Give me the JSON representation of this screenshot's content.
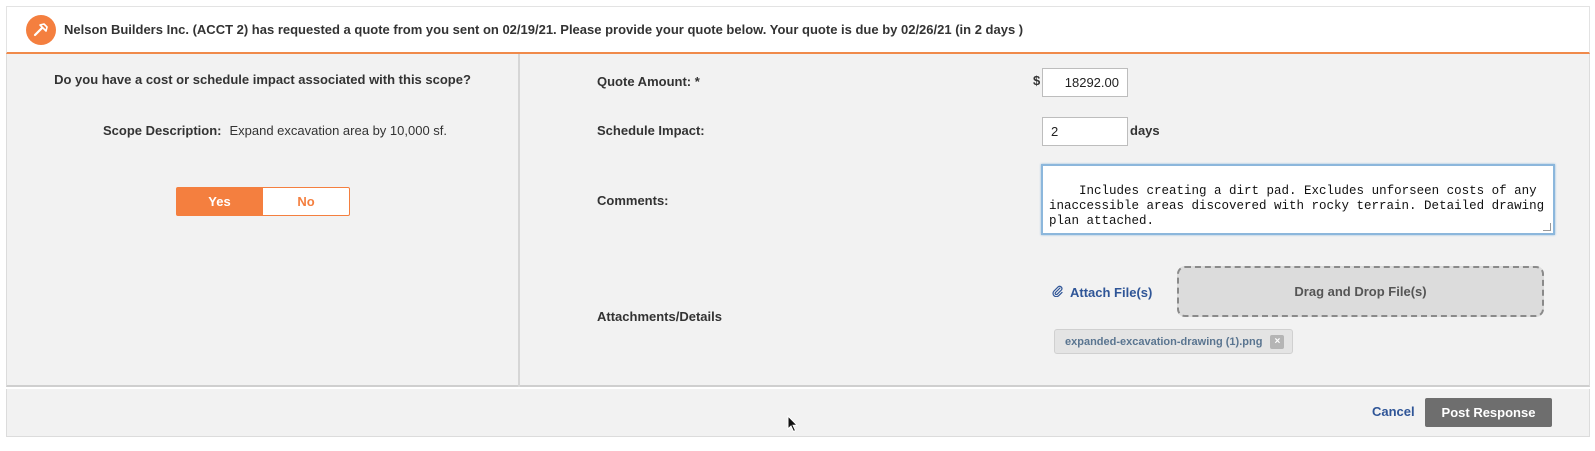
{
  "banner": {
    "icon": "hammer-icon",
    "message": "Nelson Builders Inc. (ACCT 2) has requested a quote from you sent on 02/19/21. Please provide your quote below. Your quote is due by 02/26/21 (in 2 days )"
  },
  "left": {
    "question": "Do you have a cost or schedule impact associated with this scope?",
    "scope_label": "Scope Description:",
    "scope_value": "Expand excavation area by 10,000 sf.",
    "toggle": {
      "yes_label": "Yes",
      "no_label": "No",
      "selected": "Yes"
    }
  },
  "form": {
    "quote_label": "Quote Amount: *",
    "currency_symbol": "$",
    "quote_value": "18292.00",
    "schedule_label": "Schedule Impact:",
    "schedule_value": "2",
    "schedule_unit": "days",
    "comments_label": "Comments:",
    "comments_value": "Includes creating a dirt pad. Excludes unforseen costs of any inaccessible areas discovered with rocky terrain. Detailed drawing plan attached.",
    "attachments_label": "Attachments/Details",
    "attach_link": "Attach File(s)",
    "dropzone_label": "Drag and Drop File(s)",
    "attached_files": [
      "expanded-excavation-drawing (1).png"
    ]
  },
  "footer": {
    "cancel_label": "Cancel",
    "post_label": "Post Response"
  },
  "colors": {
    "accent": "#f47f3f",
    "link": "#2f5597",
    "primary_button": "#6e6e6e"
  }
}
